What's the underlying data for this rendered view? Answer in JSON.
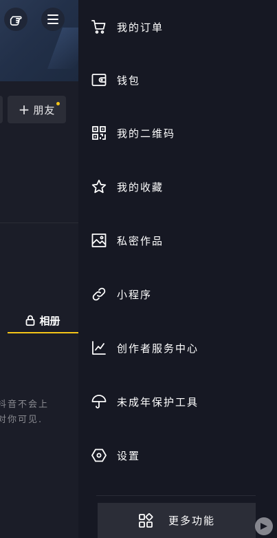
{
  "profile": {
    "add_friend_label": "朋友",
    "album_tab_label": "相册",
    "private_note_lines": [
      "抖音不会上",
      "对你可见."
    ]
  },
  "drawer": {
    "items": [
      {
        "label": "我的订单",
        "icon": "cart-icon"
      },
      {
        "label": "钱包",
        "icon": "wallet-icon"
      },
      {
        "label": "我的二维码",
        "icon": "qr-code-icon"
      },
      {
        "label": "我的收藏",
        "icon": "star-icon"
      },
      {
        "label": "私密作品",
        "icon": "image-icon"
      },
      {
        "label": "小程序",
        "icon": "link-icon"
      },
      {
        "label": "创作者服务中心",
        "icon": "chart-icon"
      },
      {
        "label": "未成年保护工具",
        "icon": "umbrella-icon"
      },
      {
        "label": "设置",
        "icon": "settings-hexagon-icon"
      }
    ],
    "more_label": "更多功能"
  },
  "colors": {
    "background": "#161823",
    "accent": "#f5c518",
    "button_bg": "#2b2d37"
  }
}
